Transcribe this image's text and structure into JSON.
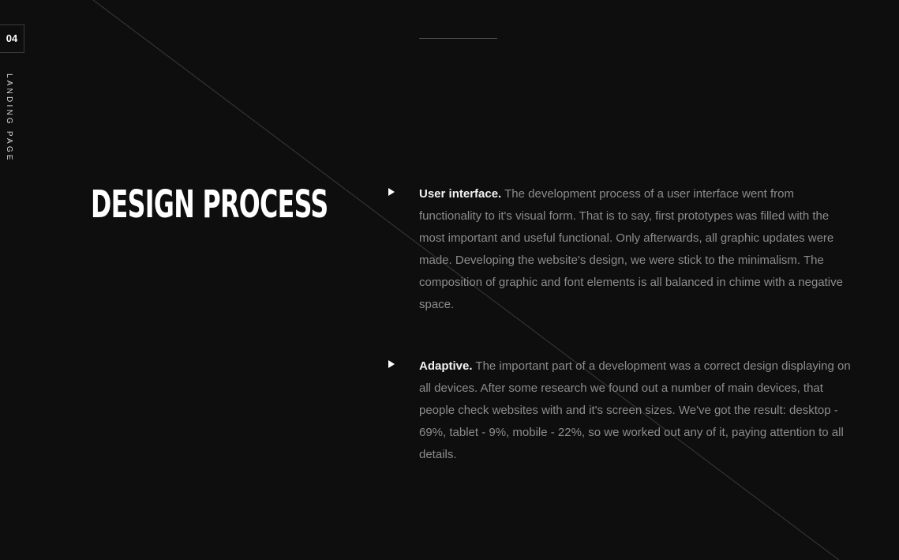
{
  "page_number": "04",
  "section_label": "LANDING PAGE",
  "headline": "DESIGN PROCESS",
  "items": [
    {
      "title": "User interface.",
      "text": "The development process of a user interface went from functionality to it's visual form. That is to say, first prototypes was filled with the most important and useful functional. Only afterwards, all graphic updates were made. Developing the website's design, we were stick to the minimalism. The composition of graphic and font elements is all balanced in chime with a negative space."
    },
    {
      "title": "Adaptive.",
      "text": "The important part of a development was a correct design displaying on all devices. After some research we found out a number of main devices, that people check websites with and it's screen sizes. We've got the result: desktop - 69%, tablet - 9%,  mobile - 22%, so we worked out any of it, paying attention to all details."
    }
  ],
  "icons": {
    "bullet": "triangle-right-icon"
  },
  "colors": {
    "background": "#0e0e0e",
    "heading": "#ffffff",
    "body_text": "#8c8c8c",
    "item_title": "#f2f2f2",
    "diagonal_line": "#3a3a3a"
  }
}
